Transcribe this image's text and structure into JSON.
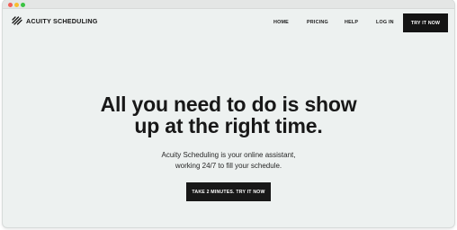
{
  "window": {
    "controls": [
      "close",
      "minimize",
      "maximize"
    ]
  },
  "header": {
    "logo_icon": "acuity-stripes-logo-icon",
    "logo_text": "ACUITY SCHEDULING",
    "nav": {
      "home": "HOME",
      "pricing": "PRICING",
      "help": "HELP",
      "login": "LOG IN"
    },
    "cta": "TRY IT NOW"
  },
  "hero": {
    "title_line1": "All you need to do is show",
    "title_line2": "up at the right time.",
    "subtitle_line1": "Acuity Scheduling is your online assistant,",
    "subtitle_line2": "working 24/7 to fill your schedule.",
    "cta": "TAKE 2 MINUTES. TRY IT NOW"
  },
  "colors": {
    "page_background": "#edf1f0",
    "button_background": "#141414",
    "button_text": "#ffffff",
    "text": "#181818"
  }
}
